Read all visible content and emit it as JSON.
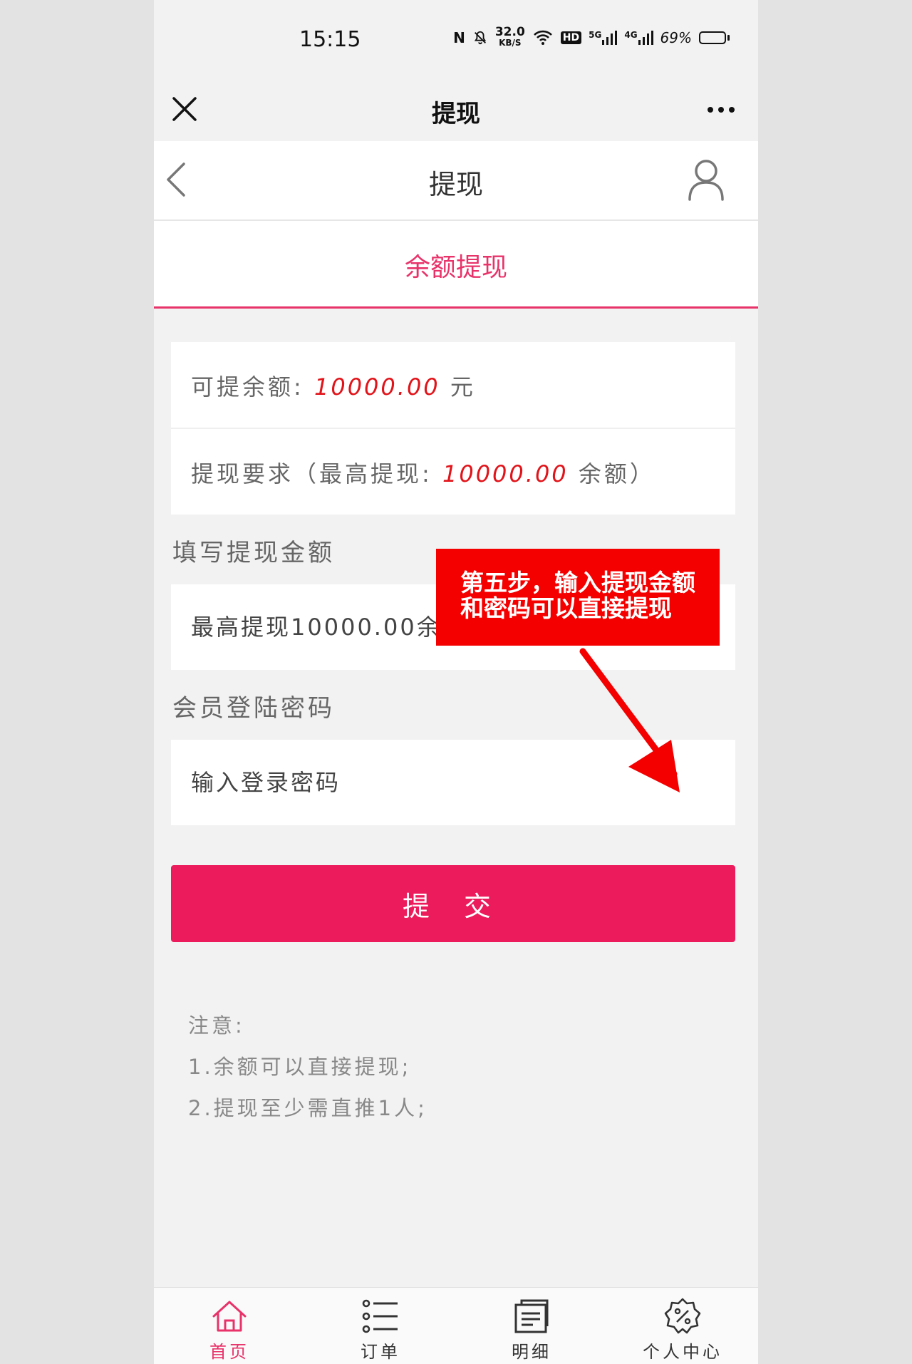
{
  "status_bar": {
    "time": "15:15",
    "nfc": "N",
    "net_speed": "32.0",
    "net_unit": "KB/S",
    "hd": "HD",
    "sim1": "5G",
    "sim2": "4G",
    "battery": "69%",
    "battery_level": 0.69
  },
  "webview": {
    "title": "提现"
  },
  "header": {
    "title": "提现"
  },
  "tab": {
    "label": "余额提现"
  },
  "balance": {
    "label": "可提余额:",
    "amount": "10000.00",
    "unit": "元"
  },
  "requirement": {
    "prefix": "提现要求（最高提现:",
    "amount": "10000.00",
    "suffix": "余额）"
  },
  "amount_field": {
    "label": "填写提现金额",
    "placeholder": "最高提现10000.00余额"
  },
  "password_field": {
    "label": "会员登陆密码",
    "placeholder": "输入登录密码"
  },
  "submit_label": "提 交",
  "notes": {
    "title": "注意:",
    "line1": "1.余额可以直接提现;",
    "line2": "2.提现至少需直推1人;"
  },
  "annotation": {
    "text": "第五步，输入提现金额和密码可以直接提现"
  },
  "nav": {
    "home": "首页",
    "orders": "订单",
    "details": "明细",
    "profile": "个人中心"
  },
  "colors": {
    "accent": "#e8336a",
    "button": "#ec1c5c",
    "amount": "#e1141a",
    "annotation": "#f40000"
  }
}
